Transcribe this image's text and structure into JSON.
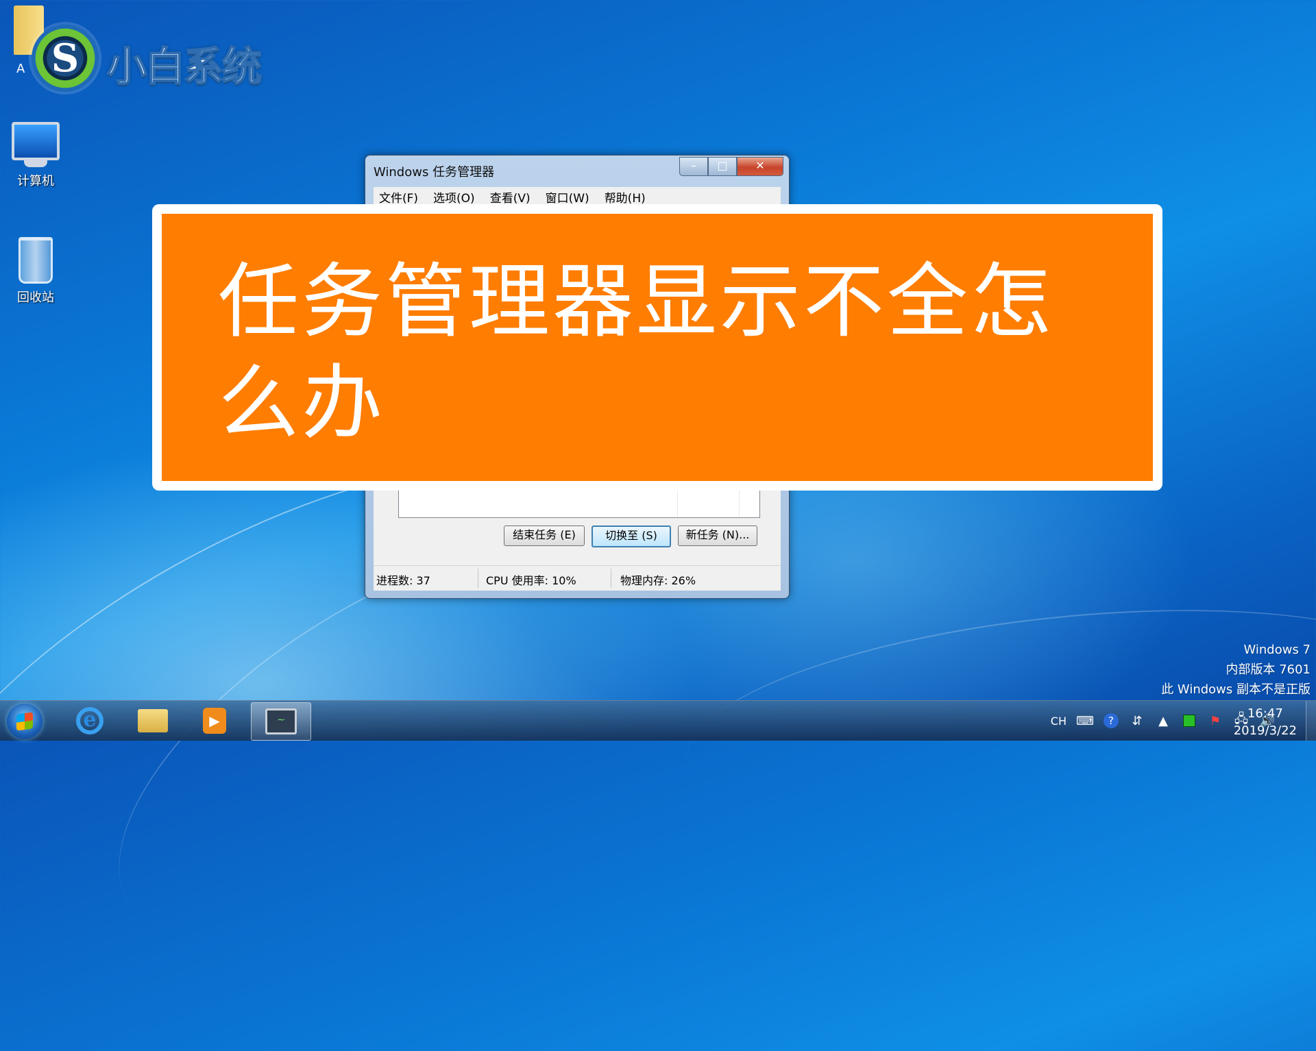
{
  "logo": {
    "brand_text": "小白系统",
    "folder_letter": "A"
  },
  "desktop": {
    "icons": [
      {
        "label": "计算机",
        "icon": "computer-icon"
      },
      {
        "label": "回收站",
        "icon": "recycle-bin-icon"
      }
    ]
  },
  "task_manager": {
    "title": "Windows 任务管理器",
    "controls": {
      "minimize": "–",
      "maximize": "□",
      "close": "✕"
    },
    "menu": [
      "文件(F)",
      "选项(O)",
      "查看(V)",
      "窗口(W)",
      "帮助(H)"
    ],
    "buttons": {
      "end_task": "结束任务 (E)",
      "switch_to": "切换至 (S)",
      "new_task": "新任务 (N)..."
    },
    "status": {
      "processes": "进程数: 37",
      "cpu": "CPU 使用率: 10%",
      "memory": "物理内存: 26%"
    }
  },
  "banner": {
    "text": "任务管理器显示不全怎么办",
    "background": "#ff7d00"
  },
  "watermark": {
    "line1": "Windows 7",
    "line2": "内部版本 7601",
    "line3": "此 Windows 副本不是正版"
  },
  "taskbar": {
    "apps": [
      "internet-explorer-icon",
      "windows-explorer-icon",
      "media-player-icon",
      "task-manager-icon"
    ],
    "tray": {
      "lang": "CH"
    },
    "clock": {
      "time": "16:47",
      "date": "2019/3/22"
    }
  }
}
